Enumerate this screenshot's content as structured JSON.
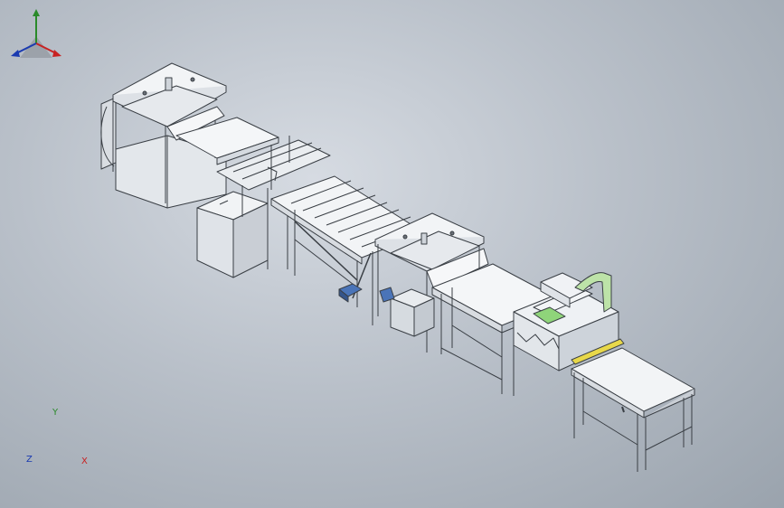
{
  "viewport": {
    "background_top": "#d6dbe2",
    "background_bottom": "#9aa3ad",
    "model_color": "#eef1f4",
    "edge_color": "#3a3f45",
    "accent_green": "#8fd47a",
    "accent_yellow": "#e8d84a",
    "accent_blue": "#4a74b8"
  },
  "triad": {
    "x_label": "X",
    "y_label": "Y",
    "z_label": "Z",
    "x_color": "#c82222",
    "y_color": "#2a8a2a",
    "z_color": "#1a3ab0"
  }
}
